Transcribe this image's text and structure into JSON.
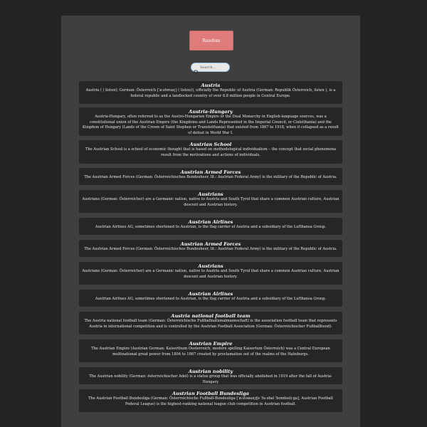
{
  "random_button": {
    "label": "Random"
  },
  "search": {
    "placeholder": "Search..."
  },
  "entries": [
    {
      "title": "Austria",
      "text": "Austria ( ( listen); German: Österreich [ˈøːstɐraɪç] ( listen)), officially the Republic of Austria (German: Republik Österreich, listen ), is a federal republic and a landlocked country of over 8.8 million people in Central Europe."
    },
    {
      "title": "Austria-Hungary",
      "text": "Austria-Hungary, often referred to as the Austro-Hungarian Empire or the Dual Monarchy in English-language sources, was a constitutional union of the Austrian Empire (the Kingdoms and Lands Represented in the Imperial Council, or Cisleithania) and the Kingdom of Hungary (Lands of the Crown of Saint Stephen or Transleithania) that existed from 1867 to 1918, when it collapsed as a result of defeat in World War I."
    },
    {
      "title": "Austrian School",
      "text": "The Austrian School is a school of economic thought that is based on methodological individualism – the concept that social phenomena result from the motivations and actions of individuals."
    },
    {
      "title": "Austrian Armed Forces",
      "text": "The Austrian Armed Forces (German: Österreichisches Bundesheer, lit.: Austrian Federal Army) is the military of the Republic of Austria."
    },
    {
      "title": "Austrians",
      "text": "Austrians (German: Österreicher) are a Germanic nation, native to Austria and South Tyrol that share a common Austrian culture, Austrian descent and Austrian history."
    },
    {
      "title": "Austrian Airlines",
      "text": "Austrian Airlines AG, sometimes shortened to Austrian, is the flag carrier of Austria and a subsidiary of the Lufthansa Group."
    },
    {
      "title": "Austrian Armed Forces",
      "text": "The Austrian Armed Forces (German: Österreichisches Bundesheer, lit.: Austrian Federal Army) is the military of the Republic of Austria."
    },
    {
      "title": "Austrians",
      "text": "Austrians (German: Österreicher) are a Germanic nation, native to Austria and South Tyrol that share a common Austrian culture, Austrian descent and Austrian history."
    },
    {
      "title": "Austrian Airlines",
      "text": "Austrian Airlines AG, sometimes shortened to Austrian, is the flag carrier of Austria and a subsidiary of the Lufthansa Group."
    },
    {
      "title": "Austria national football team",
      "text": "The Austria national football team (German: Österreichische Fußballnationalmannschaft) is the association football team that represents Austria in international competition and is controlled by the Austrian Football Association (German: Österreichischer Fußballbund)."
    },
    {
      "title": "Austrian Empire",
      "text": "The Austrian Empire (Austrian German: Kaiserthum Oesterreich, modern spelling Kaisertum Österreich) was a Central European multinational great power from 1804 to 1867 created by proclamation out of the realms of the Habsburgs."
    },
    {
      "title": "Austrian nobility",
      "text": "The Austrian nobility (German: österreichischer Adel) is a status group that was officially abolished in 1919 after the fall of Austria-Hungary."
    },
    {
      "title": "Austrian Football Bundesliga",
      "text": "The Austrian Football Bundesliga (German: Österreichische Fußball-Bundesliga [ˈøːstəʁaɪçɪʃə ˈfuːsbal ˈbʊndəsliːga], Austrian Football Federal League) is the highest-ranking national league club competition in Austrian football."
    }
  ]
}
